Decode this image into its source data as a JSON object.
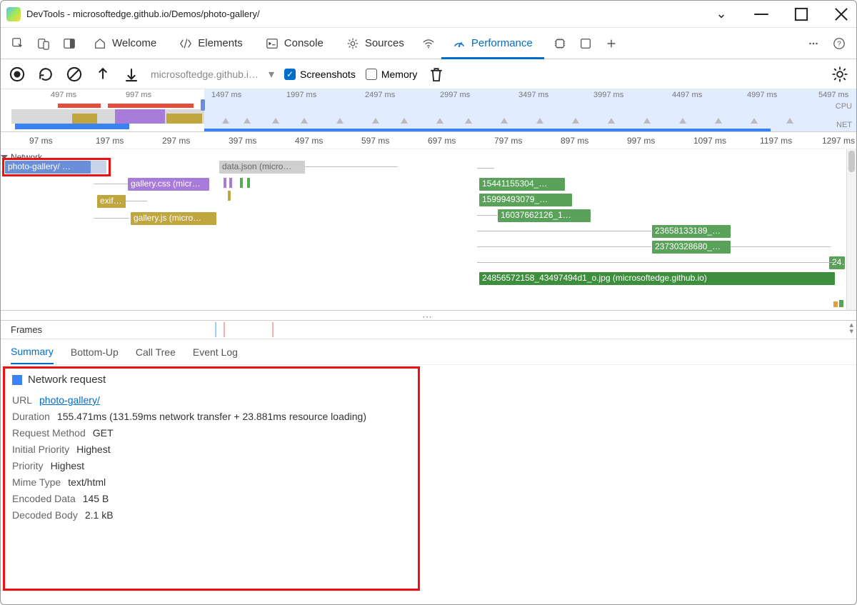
{
  "window": {
    "title": "DevTools - microsoftedge.github.io/Demos/photo-gallery/"
  },
  "tabs": {
    "welcome": "Welcome",
    "elements": "Elements",
    "console": "Console",
    "sources": "Sources",
    "performance": "Performance"
  },
  "toolbar": {
    "url": "microsoftedge.github.i…",
    "screenshots": "Screenshots",
    "memory": "Memory"
  },
  "overview": {
    "ticks": [
      "497 ms",
      "997 ms",
      "1497 ms",
      "1997 ms",
      "2497 ms",
      "2997 ms",
      "3497 ms",
      "3997 ms",
      "4497 ms",
      "4997 ms",
      "5497 ms"
    ],
    "cpu": "CPU",
    "net": "NET"
  },
  "ruler": [
    "97 ms",
    "197 ms",
    "297 ms",
    "397 ms",
    "497 ms",
    "597 ms",
    "697 ms",
    "797 ms",
    "897 ms",
    "997 ms",
    "1097 ms",
    "1197 ms",
    "1297 ms"
  ],
  "network_section": "Network",
  "bars": {
    "photo_gallery": "photo-gallery/ …",
    "datajson": "data.json (micro…",
    "gallerycss": "gallery.css (micr…",
    "exif": "exif…",
    "galleryjs": "gallery.js (micro…",
    "img1": "15441155304_…",
    "img2": "15999493079_…",
    "img3": "16037662126_1…",
    "img4": "23658133189_…",
    "img5": "23730328680_…",
    "img6": "24…",
    "img7": "24856572158_43497494d1_o.jpg (microsoftedge.github.io)"
  },
  "frames": "Frames",
  "detail_tabs": {
    "summary": "Summary",
    "bottomup": "Bottom-Up",
    "calltree": "Call Tree",
    "eventlog": "Event Log"
  },
  "summary": {
    "title": "Network request",
    "url_k": "URL",
    "url_v": "photo-gallery/",
    "dur_k": "Duration",
    "dur_v": "155.471ms (131.59ms network transfer + 23.881ms resource loading)",
    "rm_k": "Request Method",
    "rm_v": "GET",
    "ip_k": "Initial Priority",
    "ip_v": "Highest",
    "p_k": "Priority",
    "p_v": "Highest",
    "mt_k": "Mime Type",
    "mt_v": "text/html",
    "ed_k": "Encoded Data",
    "ed_v": "145 B",
    "db_k": "Decoded Body",
    "db_v": "2.1 kB"
  }
}
